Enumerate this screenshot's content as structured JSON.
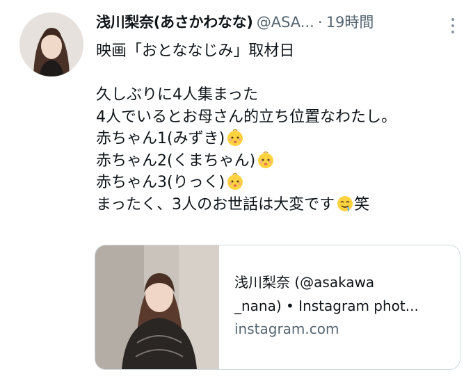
{
  "author": {
    "display_name": "浅川梨奈(あさかわなな)",
    "handle": "@ASA...",
    "separator": "·",
    "timestamp": "19時間"
  },
  "tweet": {
    "lines": [
      "映画「おとななじみ」取材日",
      "",
      "久しぶりに4人集まった",
      "4人でいるとお母さん的立ち位置なわたし。",
      "赤ちゃん1(みずき)",
      "赤ちゃん2(くまちゃん)",
      "赤ちゃん3(りっく)",
      "まったく、3人のお世話は大変です",
      "笑"
    ],
    "emoji": {
      "baby": "baby-face-emoji",
      "drooling": "drooling-face-emoji"
    }
  },
  "link_card": {
    "title_line1": "浅川梨奈 (@asakawa",
    "title_line2": "_nana) • Instagram phot...",
    "domain": "instagram.com"
  }
}
